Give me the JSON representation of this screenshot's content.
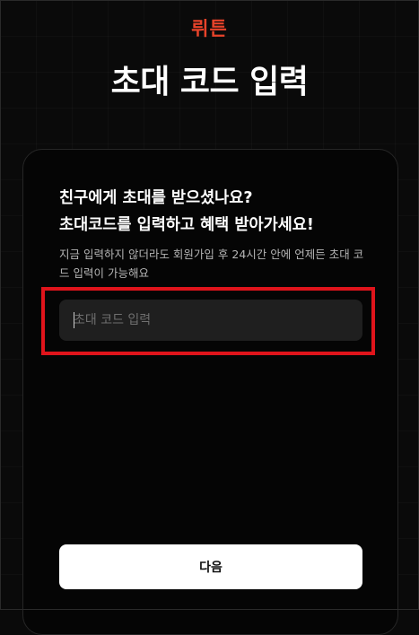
{
  "app": {
    "logo_text": "뤼튼",
    "brand_color": "#e8432a"
  },
  "page": {
    "title": "초대 코드 입력"
  },
  "card": {
    "headline_line1": "친구에게 초대를 받으셨나요?",
    "headline_line2": "초대코드를 입력하고 혜택 받아가세요!",
    "description": "지금 입력하지 않더라도 회원가입 후 24시간 안에 언제든 초대 코드 입력이 가능해요",
    "invite_code": {
      "value": "",
      "placeholder": "초대 코드 입력"
    },
    "next_label": "다음"
  },
  "colors": {
    "background": "#0a0a0a",
    "card_background": "#050505",
    "input_background": "#1f1f1f",
    "highlight_border": "#e0141b",
    "button_background": "#ffffff"
  }
}
